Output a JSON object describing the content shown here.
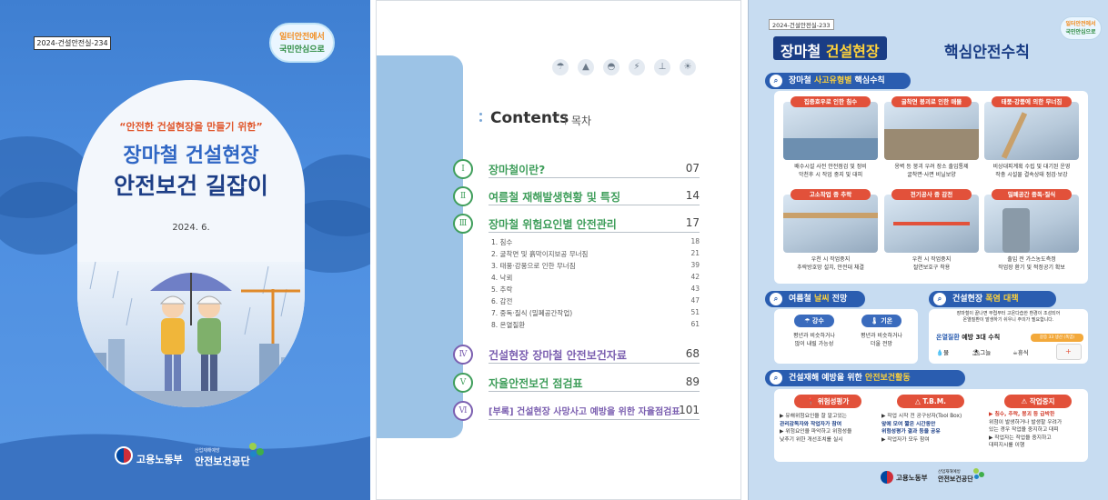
{
  "cover": {
    "doc_id": "2024-건설안전실-234",
    "badge": [
      "일터안전에서",
      "국민안심으로"
    ],
    "subtitle": "“안전한 건설현장을 만들기 위한”",
    "title_line1": "장마철 건설현장",
    "title_line2": "안전보건 길잡이",
    "date": "2024. 6.",
    "org_left": "고용노동부",
    "org_right_small": "산업재해예방",
    "org_right": "안전보건공단"
  },
  "contents": {
    "title": "Contents",
    "title_ko": "목차",
    "sections": [
      {
        "roman": "Ⅰ",
        "label": "장마철이란?",
        "page": "07",
        "color": "#3f9e5b"
      },
      {
        "roman": "Ⅱ",
        "label": "여름철 재해발생현황 및 특징",
        "page": "14",
        "color": "#3f9e5b"
      },
      {
        "roman": "Ⅲ",
        "label": "장마철 위험요인별 안전관리",
        "page": "17",
        "color": "#3f9e5b"
      },
      {
        "roman": "Ⅳ",
        "label": "건설현장 장마철 안전보건자료",
        "page": "68",
        "color": "#7b5fb0"
      },
      {
        "roman": "Ⅴ",
        "label": "자율안전보건 점검표",
        "page": "89",
        "color": "#3f9e5b"
      },
      {
        "roman": "Ⅵ",
        "label": "[부록] 건설현장 사망사고 예방을 위한 자율점검표",
        "page": "101",
        "color": "#7b5fb0"
      }
    ],
    "items": [
      {
        "label": "1. 침수",
        "page": "18"
      },
      {
        "label": "2. 굴착면 및 흙막이지보공 무너짐",
        "page": "21"
      },
      {
        "label": "3. 태풍·강풍으로 인한 무너짐",
        "page": "39"
      },
      {
        "label": "4. 낙뢰",
        "page": "42"
      },
      {
        "label": "5. 추락",
        "page": "43"
      },
      {
        "label": "6. 감전",
        "page": "47"
      },
      {
        "label": "7. 중독·질식 (밀폐공간작업)",
        "page": "51"
      },
      {
        "label": "8. 온열질환",
        "page": "61"
      }
    ]
  },
  "poster": {
    "doc_id": "2024-건설안전실-233",
    "badge": [
      "일터안전에서",
      "국민안심으로"
    ],
    "title_a": "장마철 ",
    "title_b": "건설현장",
    "title_c": "핵심안전수칙",
    "sec1": {
      "pre": "장마철 ",
      "hl": "사고유형별",
      "post": " 핵심수칙"
    },
    "cards": [
      {
        "cap": "집중호우로 인한 침수",
        "desc": [
          "배수시설 사전 안전점검 및 정비",
          "악천후 시 작업 중지 및 대피"
        ]
      },
      {
        "cap": "굴착면 붕괴로 인한 매몰",
        "desc": [
          "옹벽 등 붕괴 우려 장소 출입통제",
          "굴착면·사면 비닐보양"
        ]
      },
      {
        "cap": "태풍·강풍에 의한 무너짐",
        "desc": [
          "비상대피계획 수립 및 대기된 운영",
          "작충 시설물 결속상태 점검·보강"
        ]
      },
      {
        "cap": "고소작업 중 추락",
        "desc": [
          "우천 시 작업중지",
          "추락방호망 설치, 안전대 체결"
        ]
      },
      {
        "cap": "전기공사 중 감전",
        "desc": [
          "우천 시 작업중지",
          "절연보호구 착용"
        ]
      },
      {
        "cap": "밀폐공간 중독·질식",
        "desc": [
          "출입 전 가스농도측정",
          "작업장 환기 및 적정공기 확보"
        ]
      }
    ],
    "sec2": {
      "pre": "여름철 ",
      "hl": "날씨",
      "post": " 전망"
    },
    "weather": [
      {
        "chip": "강수",
        "desc": [
          "평년과 비슷하거나",
          "많이 내릴 가능성"
        ]
      },
      {
        "chip": "기온",
        "desc": [
          "평년과 비슷하거나",
          "더울 전망"
        ]
      }
    ],
    "sec3": {
      "pre": "건설현장 ",
      "hl": "폭염 대책"
    },
    "heat_note": [
      "장마철이 끝나면 무렵부터 고온다습한 환경이 조성되어",
      "온열질환이 발생하기 쉬우니 주의가 필요합니다."
    ],
    "heat_rule": {
      "hl": "온열질환",
      "post": " 예방 3대 수칙"
    },
    "heat_tag": "갈증 33 생산 (폭염)",
    "heat_words": [
      "물",
      "그늘",
      "휴식"
    ],
    "sec4": {
      "pre": "건설재해 예방을 위한 ",
      "hl": "안전보건활동"
    },
    "activities": [
      {
        "hdr": "위험성평가",
        "bul": [
          "▶ 유해위험요인을 잘 알고있는",
          "관리감독자와 작업자가 참여",
          "▶ 위험요인을 파악하고 위험성을",
          "낮추기 위한 개선조치를 실시"
        ]
      },
      {
        "hdr": "T.B.M.",
        "bul": [
          "▶ 작업 시작 전 공구상자(Tool Box)",
          "앞에 모여 짧은 시간동안",
          "위험성평가 결과 등을 공유",
          "▶ 작업자가 모두 참여"
        ]
      },
      {
        "hdr": "작업중지",
        "bul": [
          "▶ 침수, 추락, 붕괴 등 급박한",
          "위험이 발생하거나 발생할 우려가",
          "있는 경우 작업을 중지하고 대피",
          "▶ 작업자는 작업을 중지하고",
          "대피지시를 이행"
        ]
      }
    ],
    "foot_org_left": "고용노동부",
    "foot_org_right_small": "산업재해예방",
    "foot_org_right": "안전보건공단"
  },
  "colors": {
    "cover_bg": "#4d8ee0",
    "navy": "#1a3d85",
    "accent_red": "#e2513a",
    "band_blue": "#9cc3e6",
    "poster_bg": "#c7dcf1"
  }
}
